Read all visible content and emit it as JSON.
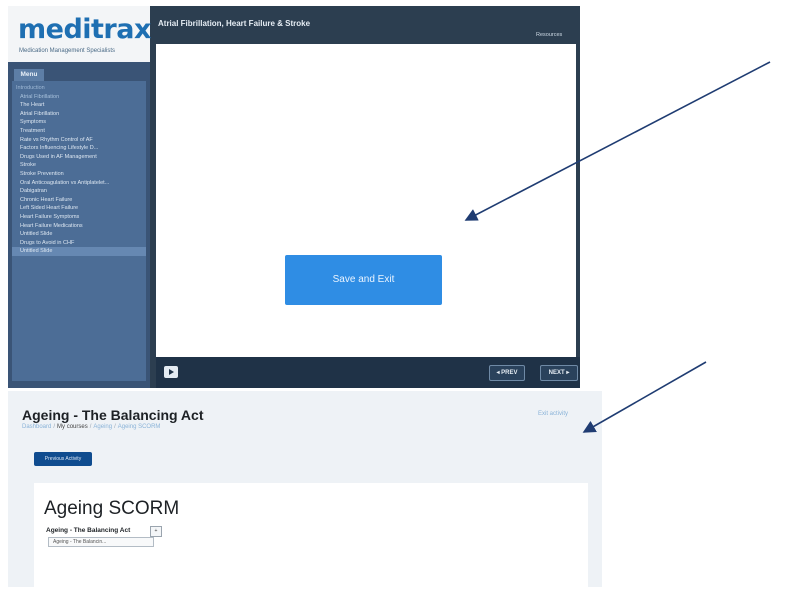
{
  "colors": {
    "logo_blue": "#1e6fb2",
    "player_dark": "#2c3e50",
    "sidebar_blue": "#3a5476",
    "save_button_blue": "#2f8de4",
    "arrow_navy": "#1f3c72",
    "moodle_primary": "#0f4c8f",
    "page_background": "#eef2f6"
  },
  "player": {
    "logo": {
      "word": "meditrax",
      "tagline": "Medication Management Specialists"
    },
    "menu_tab": "Menu",
    "title": "Atrial Fibrillation, Heart Failure & Stroke",
    "resources": "Resources",
    "menu_items": [
      {
        "label": "Introduction",
        "kind": "section"
      },
      {
        "label": "Atrial Fibrillation",
        "kind": "muted"
      },
      {
        "label": "The Heart",
        "kind": "item"
      },
      {
        "label": "Atrial Fibrillation",
        "kind": "item"
      },
      {
        "label": "Symptoms",
        "kind": "item"
      },
      {
        "label": "Treatment",
        "kind": "item"
      },
      {
        "label": "Rate vs Rhythm Control of AF",
        "kind": "item"
      },
      {
        "label": "Factors Influencing Lifestyle D...",
        "kind": "item"
      },
      {
        "label": "Drugs Used in AF Management",
        "kind": "item"
      },
      {
        "label": "Stroke",
        "kind": "item"
      },
      {
        "label": "Stroke Prevention",
        "kind": "item"
      },
      {
        "label": "Oral Anticoagulation vs Antiplatelet...",
        "kind": "item"
      },
      {
        "label": "Dabigatran",
        "kind": "item"
      },
      {
        "label": "Chronic Heart Failure",
        "kind": "item"
      },
      {
        "label": "Left Sided Heart Failure",
        "kind": "item"
      },
      {
        "label": "Heart Failure Symptoms",
        "kind": "item"
      },
      {
        "label": "Heart Failure Medications",
        "kind": "item"
      },
      {
        "label": "Untitled Slide",
        "kind": "item"
      },
      {
        "label": "Drugs to Avoid in CHF",
        "kind": "item"
      },
      {
        "label": "Untitled Slide",
        "kind": "current"
      }
    ],
    "save_exit_label": "Save and Exit",
    "prev_label": "◂ PREV",
    "next_label": "NEXT ▸",
    "play_icon": "play-icon"
  },
  "course": {
    "title": "Ageing - The Balancing Act",
    "breadcrumb": [
      "Dashboard",
      "My courses",
      "Ageing",
      "Ageing SCORM"
    ],
    "exit_activity": "Exit activity",
    "previous_activity": "Previous Activity",
    "scorm_title": "Ageing SCORM",
    "toc_label": "Ageing - The Balancing Act",
    "toc_toggle": "+",
    "toc_select_value": "Ageing - The Balancin..."
  }
}
